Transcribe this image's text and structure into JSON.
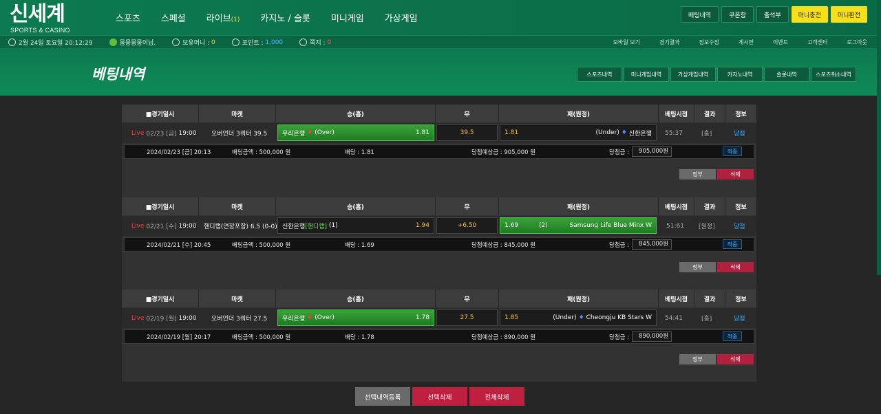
{
  "brand": {
    "name": "신세계",
    "sub": "SPORTS & CASINO"
  },
  "nav": [
    {
      "label": "스포츠",
      "count": ""
    },
    {
      "label": "스페셜",
      "count": ""
    },
    {
      "label": "라이브",
      "count": "(1)"
    },
    {
      "label": "카지노 / 슬롯",
      "count": ""
    },
    {
      "label": "미니게임",
      "count": ""
    },
    {
      "label": "가상게임",
      "count": ""
    }
  ],
  "top_buttons": [
    "배팅내역",
    "쿠폰함",
    "출석부",
    "머니충전",
    "머니환전"
  ],
  "info": {
    "datetime": "2월 24일 토요일 20:12:29",
    "user": "뭉뭉뭉뭉이님.",
    "money_label": "보유머니 :",
    "money_value": "0",
    "point_label": "포인트 :",
    "point_value": "1,000",
    "msg_label": "쪽지 :",
    "msg_value": "0"
  },
  "info_links": [
    "모바일 보기",
    "경기결과",
    "정보수정",
    "게시판",
    "이벤트",
    "고객센터",
    "로그아웃"
  ],
  "page_title": "베팅내역",
  "history_tabs": [
    "스포츠내역",
    "미니게임내역",
    "가상게임내역",
    "카지노내역",
    "슬롯내역",
    "스포츠취소내역"
  ],
  "table_headers": [
    "■경기일시",
    "마켓",
    "승(홈)",
    "무",
    "패(원정)",
    "베팅시점",
    "결과",
    "정보"
  ],
  "bets": [
    {
      "live": "Live",
      "date": "02/23 [금]",
      "time": "19:00",
      "market": "오버언더 3쿼터 39.5",
      "home": "우리은행",
      "home_tag": "(Over)",
      "home_odds": "1.81",
      "draw": "39.5",
      "away_odds": "1.81",
      "away_tag": "(Under)",
      "away": "신한은행",
      "selected": "home",
      "bet_time": "55:37",
      "result": "[홈]",
      "status": "당첨",
      "placed": "2024/02/23 [금] 20:13",
      "amount": "배팅금액 : 500,000 원",
      "rate": "배당 : 1.81",
      "expected": "당첨예상금 : 905,000 원",
      "win_label": "당첨금 :",
      "win_value": "905,000원",
      "apply": "적중"
    },
    {
      "live": "Live",
      "date": "02/21 [수]",
      "time": "19:00",
      "market": "핸디캡(연장포함) 6.5 (0-0)",
      "home": "신한은행",
      "home_tag": "[핸디캡]",
      "home_tag2": "(1)",
      "home_odds": "1.94",
      "draw": "+6.50",
      "away_odds": "1.69",
      "away_tag": "(2)",
      "away": "Samsung Life Blue Minx W",
      "selected": "away",
      "bet_time": "51:61",
      "result": "[원정]",
      "status": "당첨",
      "placed": "2024/02/21 [수] 20:45",
      "amount": "배팅금액 : 500,000 원",
      "rate": "배당 : 1.69",
      "expected": "당첨예상금 : 845,000 원",
      "win_label": "당첨금 :",
      "win_value": "845,000원",
      "apply": "적중"
    },
    {
      "live": "Live",
      "date": "02/19 [월]",
      "time": "19:00",
      "market": "오버언더 3쿼터 27.5",
      "home": "우리은행",
      "home_tag": "(Over)",
      "home_odds": "1.78",
      "draw": "27.5",
      "away_odds": "1.85",
      "away_tag": "(Under)",
      "away": "Cheongju KB Stars W",
      "selected": "home",
      "bet_time": "54:41",
      "result": "[홈]",
      "status": "당첨",
      "placed": "2024/02/19 [월] 20:17",
      "amount": "배팅금액 : 500,000 원",
      "rate": "배당 : 1.78",
      "expected": "당첨예상금 : 890,000 원",
      "win_label": "당첨금 :",
      "win_value": "890,000원",
      "apply": "적중"
    }
  ],
  "row_buttons": {
    "detail": "정부",
    "delete": "삭제"
  },
  "footer_buttons": [
    "선택내역등록",
    "선택삭제",
    "전체삭제"
  ]
}
